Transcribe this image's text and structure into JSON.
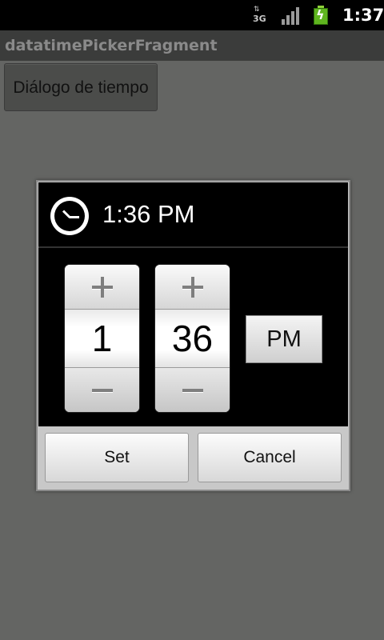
{
  "status_bar": {
    "network": "3G",
    "time": "1:37"
  },
  "title_bar": {
    "title": "datatimePickerFragment"
  },
  "main": {
    "button_label": "Diálogo de tiempo"
  },
  "dialog": {
    "title": "1:36 PM",
    "hour": "1",
    "minute": "36",
    "am_pm": "PM",
    "set_label": "Set",
    "cancel_label": "Cancel"
  },
  "colors": {
    "background": "#646563",
    "battery": "#5fb51f"
  }
}
